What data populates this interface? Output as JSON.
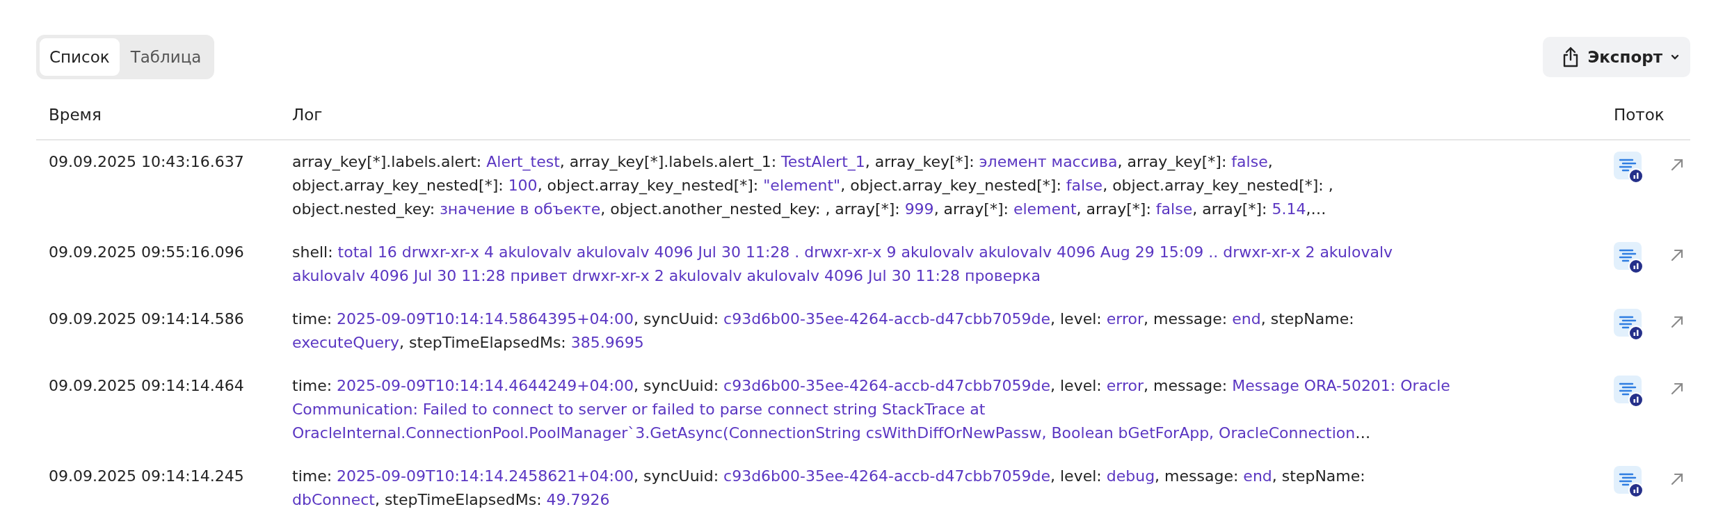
{
  "view_tabs": [
    {
      "label": "Список",
      "selected": true
    },
    {
      "label": "Таблица",
      "selected": false
    }
  ],
  "export_button": {
    "label": "Экспорт"
  },
  "table": {
    "columns": [
      "Время",
      "Лог",
      "Поток"
    ],
    "rows": [
      {
        "time": "09.09.2025 10:43:16.637",
        "log_lines": [
          [
            {
              "text": "array_key[*].labels.alert: ",
              "kind": "key"
            },
            {
              "text": "Alert_test",
              "kind": "value"
            },
            {
              "text": ", array_key[*].labels.alert_1: ",
              "kind": "key"
            },
            {
              "text": "TestAlert_1",
              "kind": "value"
            },
            {
              "text": ", array_key[*]: ",
              "kind": "key"
            },
            {
              "text": "элемент массива",
              "kind": "value"
            },
            {
              "text": ", array_key[*]: ",
              "kind": "key"
            },
            {
              "text": "false",
              "kind": "value"
            },
            {
              "text": ",",
              "kind": "key"
            }
          ],
          [
            {
              "text": "object.array_key_nested[*]: ",
              "kind": "key"
            },
            {
              "text": "100",
              "kind": "value"
            },
            {
              "text": ", object.array_key_nested[*]: ",
              "kind": "key"
            },
            {
              "text": "\"element\"",
              "kind": "value"
            },
            {
              "text": ", object.array_key_nested[*]: ",
              "kind": "key"
            },
            {
              "text": "false",
              "kind": "value"
            },
            {
              "text": ", object.array_key_nested[*]: ,",
              "kind": "key"
            }
          ],
          [
            {
              "text": "object.nested_key: ",
              "kind": "key"
            },
            {
              "text": "значение в объекте",
              "kind": "value"
            },
            {
              "text": ", object.another_nested_key: , array[*]: ",
              "kind": "key"
            },
            {
              "text": "999",
              "kind": "value"
            },
            {
              "text": ", array[*]: ",
              "kind": "key"
            },
            {
              "text": "element",
              "kind": "value"
            },
            {
              "text": ", array[*]: ",
              "kind": "key"
            },
            {
              "text": "false",
              "kind": "value"
            },
            {
              "text": ", array[*]: ",
              "kind": "key"
            },
            {
              "text": "5.14",
              "kind": "value"
            },
            {
              "text": ",…",
              "kind": "key"
            }
          ]
        ]
      },
      {
        "time": "09.09.2025 09:55:16.096",
        "log_lines": [
          [
            {
              "text": "shell: ",
              "kind": "key"
            },
            {
              "text": "total 16 drwxr-xr-x 4 akulovalv akulovalv 4096 Jul 30 11:28 . drwxr-xr-x 9 akulovalv akulovalv 4096 Aug 29 15:09 .. drwxr-xr-x 2 akulovalv",
              "kind": "value"
            }
          ],
          [
            {
              "text": "akulovalv 4096 Jul 30 11:28 привет drwxr-xr-x 2 akulovalv akulovalv 4096 Jul 30 11:28 проверка",
              "kind": "value"
            }
          ]
        ]
      },
      {
        "time": "09.09.2025 09:14:14.586",
        "log_lines": [
          [
            {
              "text": "time: ",
              "kind": "key"
            },
            {
              "text": "2025-09-09T10:14:14.5864395+04:00",
              "kind": "value"
            },
            {
              "text": ", syncUuid: ",
              "kind": "key"
            },
            {
              "text": "c93d6b00-35ee-4264-accb-d47cbb7059de",
              "kind": "value"
            },
            {
              "text": ", level: ",
              "kind": "key"
            },
            {
              "text": "error",
              "kind": "value"
            },
            {
              "text": ", message: ",
              "kind": "key"
            },
            {
              "text": "end",
              "kind": "value"
            },
            {
              "text": ", stepName:",
              "kind": "key"
            }
          ],
          [
            {
              "text": "executeQuery",
              "kind": "value"
            },
            {
              "text": ", stepTimeElapsedMs: ",
              "kind": "key"
            },
            {
              "text": "385.9695",
              "kind": "value"
            }
          ]
        ]
      },
      {
        "time": "09.09.2025 09:14:14.464",
        "log_lines": [
          [
            {
              "text": "time: ",
              "kind": "key"
            },
            {
              "text": "2025-09-09T10:14:14.4644249+04:00",
              "kind": "value"
            },
            {
              "text": ", syncUuid: ",
              "kind": "key"
            },
            {
              "text": "c93d6b00-35ee-4264-accb-d47cbb7059de",
              "kind": "value"
            },
            {
              "text": ", level: ",
              "kind": "key"
            },
            {
              "text": "error",
              "kind": "value"
            },
            {
              "text": ", message: ",
              "kind": "key"
            },
            {
              "text": "Message ORA-50201: Oracle",
              "kind": "value"
            }
          ],
          [
            {
              "text": "Communication: Failed to connect to server or failed to parse connect string StackTrace at",
              "kind": "value"
            }
          ],
          [
            {
              "text": "OracleInternal.ConnectionPool.PoolManager`3.GetAsync(ConnectionString csWithDiffOrNewPassw, Boolean bGetForApp, OracleConnection",
              "kind": "value"
            },
            {
              "text": "…",
              "kind": "key"
            }
          ]
        ]
      },
      {
        "time": "09.09.2025 09:14:14.245",
        "log_lines": [
          [
            {
              "text": "time: ",
              "kind": "key"
            },
            {
              "text": "2025-09-09T10:14:14.2458621+04:00",
              "kind": "value"
            },
            {
              "text": ", syncUuid: ",
              "kind": "key"
            },
            {
              "text": "c93d6b00-35ee-4264-accb-d47cbb7059de",
              "kind": "value"
            },
            {
              "text": ", level: ",
              "kind": "key"
            },
            {
              "text": "debug",
              "kind": "value"
            },
            {
              "text": ", message: ",
              "kind": "key"
            },
            {
              "text": "end",
              "kind": "value"
            },
            {
              "text": ", stepName:",
              "kind": "key"
            }
          ],
          [
            {
              "text": "dbConnect",
              "kind": "value"
            },
            {
              "text": ", stepTimeElapsedMs: ",
              "kind": "key"
            },
            {
              "text": "49.7926",
              "kind": "value"
            }
          ]
        ]
      }
    ]
  }
}
